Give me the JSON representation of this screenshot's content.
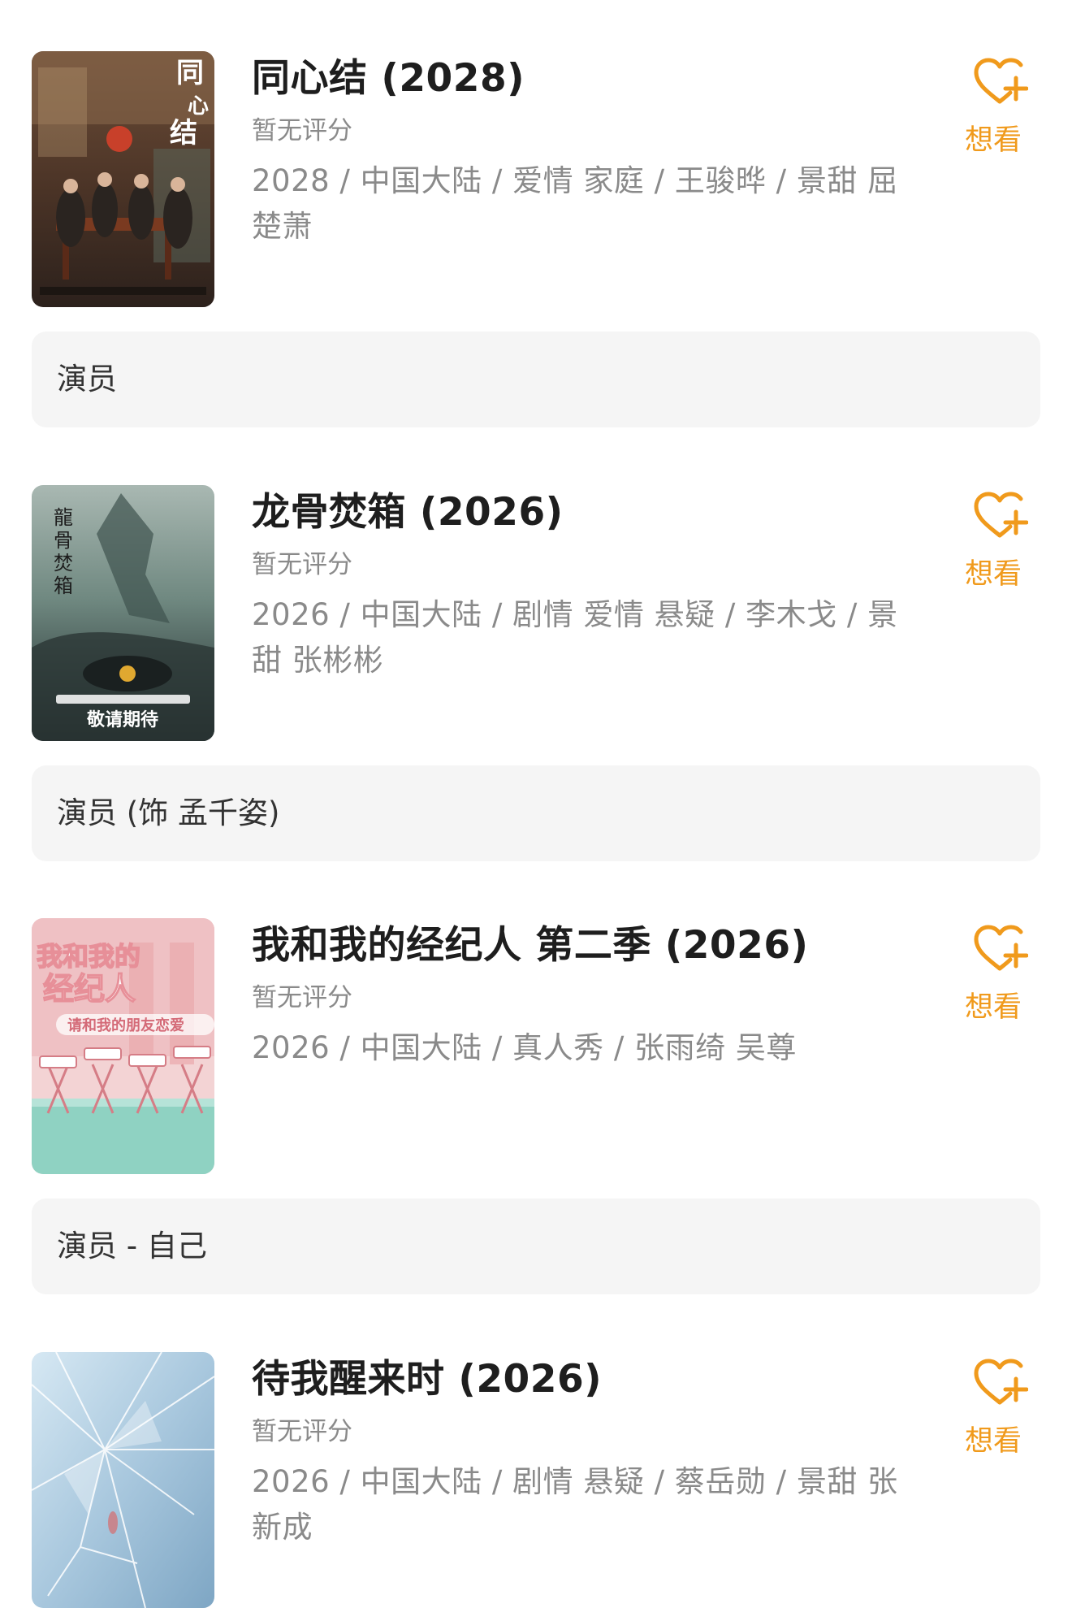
{
  "items": [
    {
      "title": "同心结 (2028)",
      "rating": "暂无评分",
      "meta": "2028 / 中国大陆 / 爱情 家庭 / 王骏晔 / 景甜 屈楚萧",
      "wish_label": "想看",
      "role": "演员",
      "poster_text": "同心结"
    },
    {
      "title": "龙骨焚箱 (2026)",
      "rating": "暂无评分",
      "meta": "2026 / 中国大陆 / 剧情 爱情 悬疑 / 李木戈 / 景甜 张彬彬",
      "wish_label": "想看",
      "role": "演员 (饰 孟千姿)",
      "poster_text": "龍骨焚箱",
      "poster_caption": "敬请期待"
    },
    {
      "title": "我和我的经纪人 第二季 (2026)",
      "rating": "暂无评分",
      "meta": "2026 / 中国大陆 / 真人秀 / 张雨绮 吴尊",
      "wish_label": "想看",
      "role": "演员 - 自己",
      "poster_text": "我和我的经纪人",
      "poster_caption": "请和我的朋友恋爱"
    },
    {
      "title": "待我醒来时 (2026)",
      "rating": "暂无评分",
      "meta": "2026 / 中国大陆 / 剧情 悬疑 / 蔡岳勋 / 景甜 张新成",
      "wish_label": "想看"
    }
  ],
  "colors": {
    "accent": "#f09a1c",
    "role_bg": "#f5f5f5",
    "muted_text": "#8a8a8a"
  },
  "icons": {
    "wish": "heart-plus-icon"
  }
}
